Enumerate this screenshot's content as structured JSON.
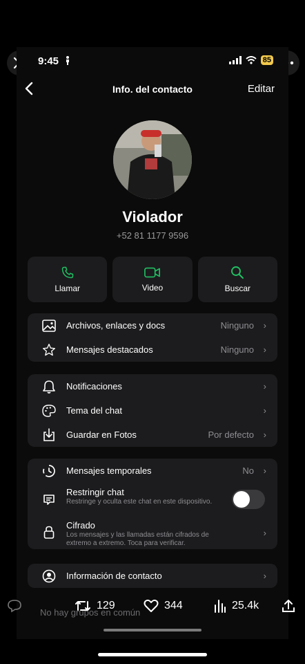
{
  "status": {
    "time": "9:45",
    "battery": "85"
  },
  "nav": {
    "title": "Info. del contacto",
    "edit": "Editar"
  },
  "contact": {
    "name": "Violador",
    "phone": "+52 81 1177 9596"
  },
  "actions": [
    {
      "label": "Llamar",
      "icon": "phone-icon"
    },
    {
      "label": "Video",
      "icon": "video-icon"
    },
    {
      "label": "Buscar",
      "icon": "search-icon"
    }
  ],
  "group1": [
    {
      "label": "Archivos, enlaces y docs",
      "value": "Ninguno",
      "icon": "image-icon"
    },
    {
      "label": "Mensajes destacados",
      "value": "Ninguno",
      "icon": "star-icon"
    }
  ],
  "group2": [
    {
      "label": "Notificaciones",
      "value": "",
      "icon": "bell-icon"
    },
    {
      "label": "Tema del chat",
      "value": "",
      "icon": "palette-icon"
    },
    {
      "label": "Guardar en Fotos",
      "value": "Por defecto",
      "icon": "download-icon"
    }
  ],
  "group3": {
    "temporales": {
      "label": "Mensajes temporales",
      "value": "No"
    },
    "restringir": {
      "label": "Restringir chat",
      "sub": "Restringe y oculta este chat en este dispositivo.",
      "enabled": false
    },
    "cifrado": {
      "label": "Cifrado",
      "sub": "Los mensajes y las llamadas están cifrados de extremo a extremo. Toca para verificar."
    }
  },
  "group4": {
    "label": "Información de contacto"
  },
  "groups_hint": "No hay grupos en común",
  "tweet": {
    "retweets": "129",
    "likes": "344",
    "views": "25.4k"
  },
  "colors": {
    "accent": "#21c063",
    "background": "#0b0b0b",
    "card": "#1c1c1e"
  }
}
